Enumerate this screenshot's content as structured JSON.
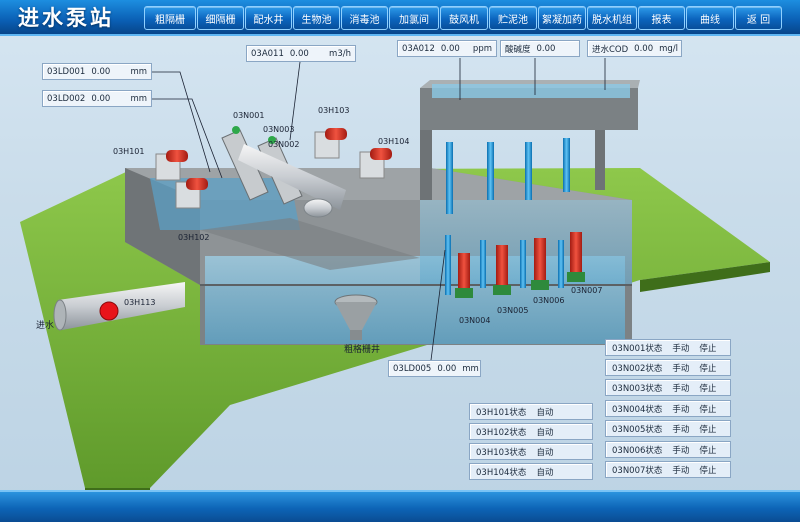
{
  "header": {
    "title": "进水泵站"
  },
  "nav": [
    {
      "label": "粗隔栅"
    },
    {
      "label": "细隔栅"
    },
    {
      "label": "配水井"
    },
    {
      "label": "生物池"
    },
    {
      "label": "消毒池"
    },
    {
      "label": "加氯间"
    },
    {
      "label": "鼓风机"
    },
    {
      "label": "贮泥池"
    },
    {
      "label": "絮凝加药"
    },
    {
      "label": "脱水机组"
    },
    {
      "label": "报表"
    },
    {
      "label": "曲线"
    },
    {
      "label": "返 回"
    }
  ],
  "readings": {
    "ld001": {
      "tag": "03LD001",
      "value": "0.00",
      "unit": "mm"
    },
    "ld002": {
      "tag": "03LD002",
      "value": "0.00",
      "unit": "mm"
    },
    "a011": {
      "tag": "03A011",
      "value": "0.00",
      "unit": "m3/h"
    },
    "a012": {
      "tag": "03A012",
      "value": "0.00",
      "unit": "ppm"
    },
    "ph": {
      "tag": "酸碱度",
      "value": "0.00",
      "unit": ""
    },
    "cod": {
      "tag": "进水COD",
      "value": "0.00",
      "unit": "mg/l"
    },
    "ld005": {
      "tag": "03LD005",
      "value": "0.00",
      "unit": "mm"
    }
  },
  "scene_labels": {
    "n001": "03N001",
    "n002": "03N002",
    "n003": "03N003",
    "h101": "03H101",
    "h102": "03H102",
    "h103": "03H103",
    "h104": "03H104",
    "h113": "03H113",
    "n004": "03N004",
    "n005": "03N005",
    "n006": "03N006",
    "n007": "03N007",
    "inlet": "进水",
    "coarse_well": "粗格栅井"
  },
  "h_status": [
    {
      "tag": "03H101状态",
      "mode": "自动"
    },
    {
      "tag": "03H102状态",
      "mode": "自动"
    },
    {
      "tag": "03H103状态",
      "mode": "自动"
    },
    {
      "tag": "03H104状态",
      "mode": "自动"
    }
  ],
  "n_status": [
    {
      "tag": "03N001状态",
      "mode": "手动",
      "state": "停止"
    },
    {
      "tag": "03N002状态",
      "mode": "手动",
      "state": "停止"
    },
    {
      "tag": "03N003状态",
      "mode": "手动",
      "state": "停止"
    },
    {
      "tag": "03N004状态",
      "mode": "手动",
      "state": "停止"
    },
    {
      "tag": "03N005状态",
      "mode": "手动",
      "state": "停止"
    },
    {
      "tag": "03N006状态",
      "mode": "手动",
      "state": "停止"
    },
    {
      "tag": "03N007状态",
      "mode": "手动",
      "state": "停止"
    }
  ],
  "colors": {
    "accent": "#0b64bd",
    "pump": "#d83a2a",
    "valve_active": "#e8141a"
  }
}
